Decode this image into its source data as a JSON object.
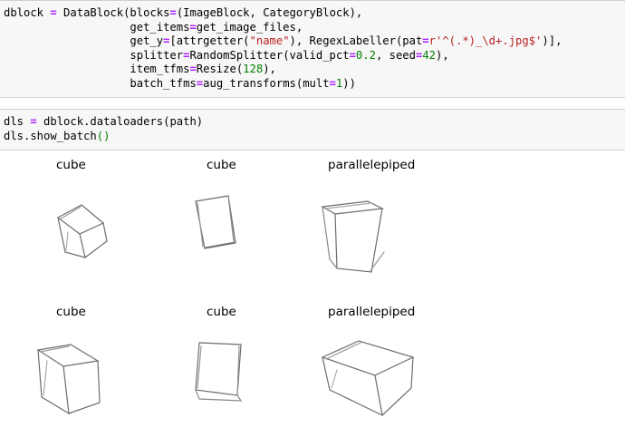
{
  "cells": [
    {
      "id": "cell-1",
      "code_lines": [
        [
          {
            "t": "dblock "
          },
          {
            "t": "=",
            "c": "op"
          },
          {
            "t": " DataBlock(blocks"
          },
          {
            "t": "=",
            "c": "op"
          },
          {
            "t": "(ImageBlock, CategoryBlock),"
          }
        ],
        [
          {
            "t": "                   get_items"
          },
          {
            "t": "=",
            "c": "op"
          },
          {
            "t": "get_image_files,"
          }
        ],
        [
          {
            "t": "                   get_y"
          },
          {
            "t": "=",
            "c": "op"
          },
          {
            "t": "[attrgetter("
          },
          {
            "t": "\"name\"",
            "c": "str"
          },
          {
            "t": "), RegexLabeller(pat"
          },
          {
            "t": "=",
            "c": "op"
          },
          {
            "t": "r'^(.*)_\\d+.jpg$'",
            "c": "str"
          },
          {
            "t": ")],"
          }
        ],
        [
          {
            "t": "                   splitter"
          },
          {
            "t": "=",
            "c": "op"
          },
          {
            "t": "RandomSplitter(valid_pct"
          },
          {
            "t": "=",
            "c": "op"
          },
          {
            "t": "0.2",
            "c": "num"
          },
          {
            "t": ", seed"
          },
          {
            "t": "=",
            "c": "op"
          },
          {
            "t": "42",
            "c": "num"
          },
          {
            "t": "),"
          }
        ],
        [
          {
            "t": "                   item_tfms"
          },
          {
            "t": "=",
            "c": "op"
          },
          {
            "t": "Resize("
          },
          {
            "t": "128",
            "c": "num"
          },
          {
            "t": "),"
          }
        ],
        [
          {
            "t": "                   batch_tfms"
          },
          {
            "t": "=",
            "c": "op"
          },
          {
            "t": "aug_transforms(mult"
          },
          {
            "t": "=",
            "c": "op"
          },
          {
            "t": "1",
            "c": "num"
          },
          {
            "t": "))"
          }
        ]
      ]
    },
    {
      "id": "cell-2",
      "code_lines": [
        [
          {
            "t": "dls "
          },
          {
            "t": "=",
            "c": "op"
          },
          {
            "t": " dblock.dataloaders(path)"
          }
        ],
        [
          {
            "t": "dls.show_batch"
          },
          {
            "t": "()",
            "c": "bi"
          }
        ]
      ]
    }
  ],
  "batch": [
    {
      "label": "cube"
    },
    {
      "label": "cube"
    },
    {
      "label": "parallelepiped"
    },
    {
      "label": "cube"
    },
    {
      "label": "cube"
    },
    {
      "label": "parallelepiped"
    }
  ]
}
